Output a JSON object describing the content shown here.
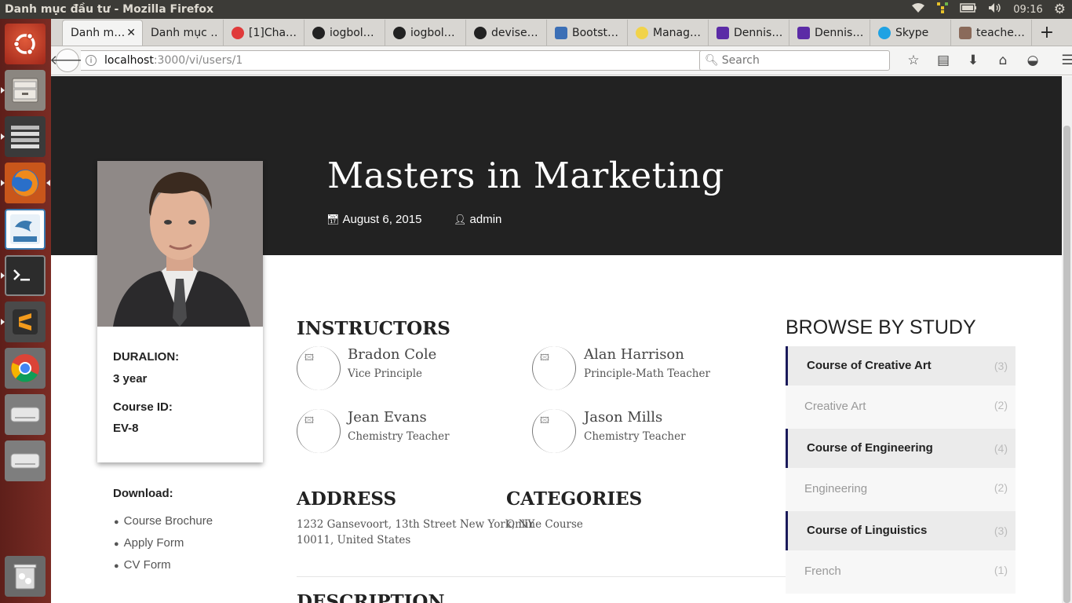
{
  "window": {
    "title": "Danh mục đầu tư - Mozilla Firefox",
    "time": "09:16"
  },
  "tabs": [
    {
      "label": "Danh m…",
      "icon": "none",
      "active": true
    },
    {
      "label": "Danh mục …",
      "icon": "none"
    },
    {
      "label": "[1]Cha…",
      "icon": "chat-icon"
    },
    {
      "label": "iogbol…",
      "icon": "github-icon"
    },
    {
      "label": "iogbol…",
      "icon": "github-icon"
    },
    {
      "label": "devise…",
      "icon": "github-icon"
    },
    {
      "label": "Bootst…",
      "icon": "bootstrap-icon"
    },
    {
      "label": "Manag…",
      "icon": "bulb-icon"
    },
    {
      "label": "Dennis…",
      "icon": "heroku-icon"
    },
    {
      "label": "Dennis…",
      "icon": "heroku-icon"
    },
    {
      "label": "Skype",
      "icon": "skype-icon"
    },
    {
      "label": "teache…",
      "icon": "photo-icon"
    }
  ],
  "url": {
    "host": "localhost",
    "path": ":3000/vi/users/1"
  },
  "search": {
    "placeholder": "Search"
  },
  "hero": {
    "title": "Masters in Marketing",
    "date": "August 6, 2015",
    "author": "admin"
  },
  "card": {
    "duration_label": "DURALION:",
    "duration_value": "3 year",
    "course_id_label": "Course ID:",
    "course_id_value": "EV-8"
  },
  "download": {
    "title": "Download:",
    "items": [
      "Course Brochure",
      "Apply Form",
      "CV Form"
    ]
  },
  "instructors": {
    "heading": "INSTRUCTORS",
    "people": [
      {
        "name": "Bradon Cole",
        "role": "Vice Principle"
      },
      {
        "name": "Alan Harrison",
        "role": "Principle-Math Teacher"
      },
      {
        "name": "Jean Evans",
        "role": "Chemistry Teacher"
      },
      {
        "name": "Jason Mills",
        "role": "Chemistry Teacher"
      }
    ]
  },
  "address": {
    "heading": "ADDRESS",
    "line1": "1232 Gansevoort, 13th Street New York, NY",
    "line2": "10011, United States"
  },
  "categories": {
    "heading": "CATEGORIES",
    "value": "Online Course"
  },
  "description": {
    "heading": "DESCRIPTION"
  },
  "browse": {
    "heading": "BROWSE BY STUDY",
    "groups": [
      {
        "title": "Course of Creative Art",
        "count": "(3)",
        "sub": "Creative Art",
        "sub_count": "(2)"
      },
      {
        "title": "Course of Engineering",
        "count": "(4)",
        "sub": "Engineering",
        "sub_count": "(2)"
      },
      {
        "title": "Course of Linguistics",
        "count": "(3)",
        "sub": "French",
        "sub_count": "(1)"
      }
    ]
  },
  "colors": {
    "hero_bg": "#222222",
    "accent_border": "#1a1a5a",
    "launcher": "#6b2620"
  }
}
